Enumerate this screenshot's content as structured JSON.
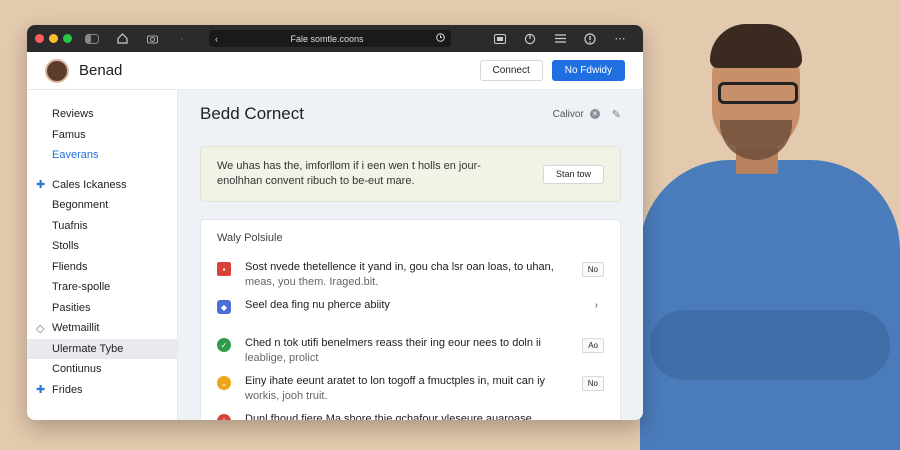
{
  "browser": {
    "url": "Fale somtle.coons",
    "colors": {
      "close": "#ff5f57",
      "minimize": "#febc2e",
      "zoom": "#28c840"
    }
  },
  "header": {
    "brand": "Benad",
    "connect_label": "Connect",
    "primary_label": "No Fdwidy"
  },
  "sidebar": {
    "items": [
      {
        "label": "Reviews"
      },
      {
        "label": "Famus"
      },
      {
        "label": "Eaverans"
      },
      {
        "label": "Cales Ickaness"
      },
      {
        "label": "Begonment"
      },
      {
        "label": "Tuafnis"
      },
      {
        "label": "Stolls"
      },
      {
        "label": "Fliends"
      },
      {
        "label": "Trare-spolle"
      },
      {
        "label": "Pasities"
      },
      {
        "label": "Wetmaillit"
      },
      {
        "label": "Ulermate Tybe"
      },
      {
        "label": "Contiunus"
      },
      {
        "label": "Frides"
      }
    ]
  },
  "main": {
    "title": "Bedd Cornect",
    "sub_label": "Calivor",
    "notice": {
      "text": "We uhas has the, imforllom if i een wen t holls en jour-enolhhan convent ribuch to be-eut mare.",
      "button": "Stan tow"
    },
    "card": {
      "title": "Waly Polsiule",
      "rows": [
        {
          "line1": "Sost nvede thetellence it yand in, gou cha lsr oan loas, to uhan,",
          "line2": "meas, you them. Iraged.bit.",
          "badge": "No",
          "icon_color": "#d9413b"
        },
        {
          "line1": "Seel dea fing nu pherce abiity",
          "line2": "",
          "badge": "›",
          "icon_color": "#4b6fd6"
        },
        {
          "line1": "Ched n tok utifi benelmers reass their ing eour nees to doln ii",
          "line2": "leablige, prolict",
          "badge": "Ao",
          "icon_color": "#2e9c4a"
        },
        {
          "line1": "Einy ihate eeunt aratet to lon togoff a fmuctples in, muit can iy",
          "line2": "workis, jooh truit.",
          "badge": "No",
          "icon_color": "#f0a61c"
        },
        {
          "line1": "Dunl fhoud fiere Ma shore thie gchafour vleseure auaroase",
          "line2": "",
          "badge": "",
          "icon_color": "#d9413b"
        }
      ]
    }
  }
}
